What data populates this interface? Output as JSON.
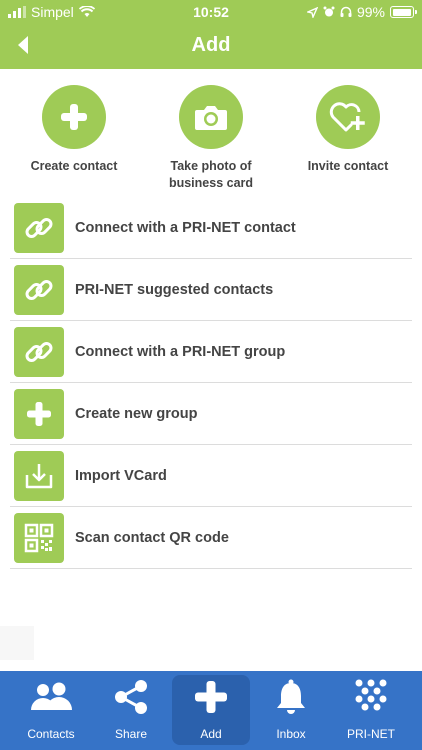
{
  "status_bar": {
    "carrier": "Simpel",
    "time": "10:52",
    "battery": "99%",
    "battery_level": 0.99
  },
  "header": {
    "title": "Add",
    "back_icon": "chevron-left-icon"
  },
  "quick_actions": [
    {
      "label": "Create contact",
      "icon": "plus-icon"
    },
    {
      "label": "Take photo of business card",
      "icon": "camera-icon"
    },
    {
      "label": "Invite contact",
      "icon": "heart-plus-icon"
    }
  ],
  "list_items": [
    {
      "label": "Connect with a PRI-NET contact",
      "icon": "link-icon"
    },
    {
      "label": "PRI-NET suggested contacts",
      "icon": "link-icon"
    },
    {
      "label": "Connect with a PRI-NET group",
      "icon": "link-icon"
    },
    {
      "label": "Create new group",
      "icon": "plus-icon"
    },
    {
      "label": "Import VCard",
      "icon": "import-icon"
    },
    {
      "label": "Scan contact QR code",
      "icon": "qr-code-icon"
    }
  ],
  "tabs": [
    {
      "label": "Contacts",
      "icon": "contacts-icon"
    },
    {
      "label": "Share",
      "icon": "share-icon"
    },
    {
      "label": "Add",
      "icon": "plus-icon",
      "active": true
    },
    {
      "label": "Inbox",
      "icon": "bell-icon"
    },
    {
      "label": "PRI-NET",
      "icon": "grid-dots-icon"
    }
  ],
  "colors": {
    "accent_green": "#9fcb56",
    "tabbar_blue": "#3673c7",
    "tab_active_blue": "#2b61ad",
    "text_dark": "#444444"
  }
}
